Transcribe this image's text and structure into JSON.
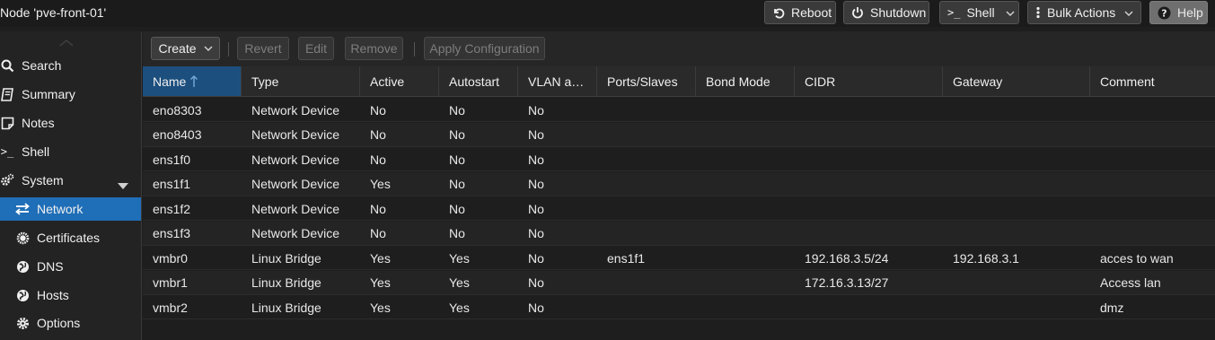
{
  "header": {
    "title": "Node 'pve-front-01'",
    "buttons": {
      "reboot": "Reboot",
      "shutdown": "Shutdown",
      "shell": "Shell",
      "bulk_actions": "Bulk Actions",
      "help": "Help"
    }
  },
  "sidebar": {
    "items": [
      {
        "label": "Search",
        "icon": "search-icon"
      },
      {
        "label": "Summary",
        "icon": "book-icon"
      },
      {
        "label": "Notes",
        "icon": "notes-icon"
      },
      {
        "label": "Shell",
        "icon": "terminal-icon"
      },
      {
        "label": "System",
        "icon": "cogs-icon"
      },
      {
        "label": "Network",
        "icon": "exchange-icon"
      },
      {
        "label": "Certificates",
        "icon": "certificate-icon"
      },
      {
        "label": "DNS",
        "icon": "globe-icon"
      },
      {
        "label": "Hosts",
        "icon": "globe-icon"
      },
      {
        "label": "Options",
        "icon": "gear-icon"
      }
    ]
  },
  "toolbar": {
    "create": "Create",
    "revert": "Revert",
    "edit": "Edit",
    "remove": "Remove",
    "apply": "Apply Configuration"
  },
  "grid": {
    "columns": [
      "Name",
      "Type",
      "Active",
      "Autostart",
      "VLAN a…",
      "Ports/Slaves",
      "Bond Mode",
      "CIDR",
      "Gateway",
      "Comment"
    ],
    "rows": [
      [
        "eno8303",
        "Network Device",
        "No",
        "No",
        "No",
        "",
        "",
        "",
        "",
        ""
      ],
      [
        "eno8403",
        "Network Device",
        "No",
        "No",
        "No",
        "",
        "",
        "",
        "",
        ""
      ],
      [
        "ens1f0",
        "Network Device",
        "No",
        "No",
        "No",
        "",
        "",
        "",
        "",
        ""
      ],
      [
        "ens1f1",
        "Network Device",
        "Yes",
        "No",
        "No",
        "",
        "",
        "",
        "",
        ""
      ],
      [
        "ens1f2",
        "Network Device",
        "No",
        "No",
        "No",
        "",
        "",
        "",
        "",
        ""
      ],
      [
        "ens1f3",
        "Network Device",
        "No",
        "No",
        "No",
        "",
        "",
        "",
        "",
        ""
      ],
      [
        "vmbr0",
        "Linux Bridge",
        "Yes",
        "Yes",
        "No",
        "ens1f1",
        "",
        "192.168.3.5/24",
        "192.168.3.1",
        "acces to wan"
      ],
      [
        "vmbr1",
        "Linux Bridge",
        "Yes",
        "Yes",
        "No",
        "",
        "",
        "172.16.3.13/27",
        "",
        "Access lan"
      ],
      [
        "vmbr2",
        "Linux Bridge",
        "Yes",
        "Yes",
        "No",
        "",
        "",
        "",
        "",
        "dmz"
      ]
    ]
  },
  "colors": {
    "accent": "#1f6eb8",
    "sorted_header": "#1c4f7e",
    "background": "#1e1e1e"
  }
}
